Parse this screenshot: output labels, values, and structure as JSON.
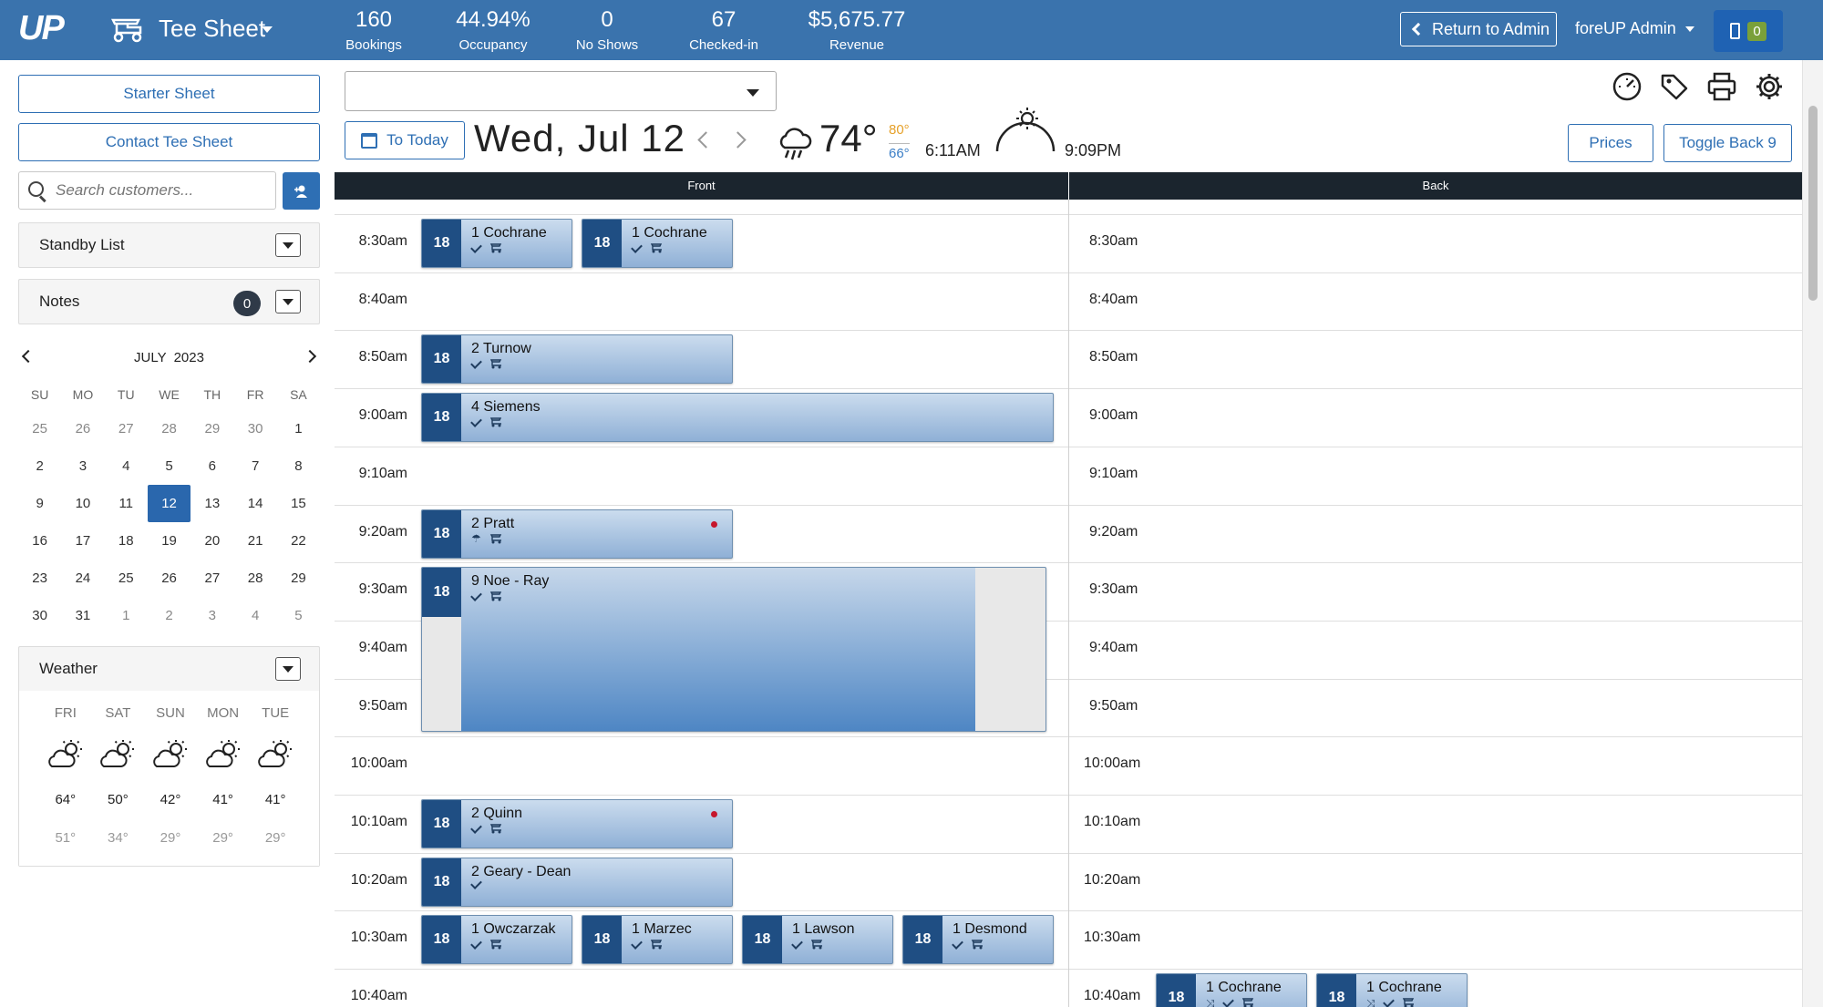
{
  "app": {
    "logo": "UP",
    "title": "Tee Sheet",
    "return_label": "Return to Admin",
    "admin_label": "foreUP Admin",
    "phone_count": "0",
    "cart_icon": "golf-cart-icon"
  },
  "stats": [
    {
      "value": "160",
      "label": "Bookings"
    },
    {
      "value": "44.94%",
      "label": "Occupancy"
    },
    {
      "value": "0",
      "label": "No Shows"
    },
    {
      "value": "67",
      "label": "Checked-in"
    },
    {
      "value": "$5,675.77",
      "label": "Revenue"
    }
  ],
  "sidebar": {
    "starter_sheet": "Starter Sheet",
    "contact_tee_sheet": "Contact Tee Sheet",
    "search_placeholder": "Search customers...",
    "standby": "Standby List",
    "notes": "Notes",
    "notes_count": "0",
    "weather": "Weather"
  },
  "calendar": {
    "month": "JULY",
    "year": "2023",
    "dow": [
      "SU",
      "MO",
      "TU",
      "WE",
      "TH",
      "FR",
      "SA"
    ],
    "days": [
      {
        "d": "25",
        "m": true
      },
      {
        "d": "26",
        "m": true
      },
      {
        "d": "27",
        "m": true
      },
      {
        "d": "28",
        "m": true
      },
      {
        "d": "29",
        "m": true
      },
      {
        "d": "30",
        "m": true
      },
      {
        "d": "1"
      },
      {
        "d": "2"
      },
      {
        "d": "3"
      },
      {
        "d": "4"
      },
      {
        "d": "5"
      },
      {
        "d": "6"
      },
      {
        "d": "7"
      },
      {
        "d": "8"
      },
      {
        "d": "9"
      },
      {
        "d": "10"
      },
      {
        "d": "11"
      },
      {
        "d": "12",
        "sel": true
      },
      {
        "d": "13"
      },
      {
        "d": "14"
      },
      {
        "d": "15"
      },
      {
        "d": "16"
      },
      {
        "d": "17"
      },
      {
        "d": "18"
      },
      {
        "d": "19"
      },
      {
        "d": "20"
      },
      {
        "d": "21"
      },
      {
        "d": "22"
      },
      {
        "d": "23"
      },
      {
        "d": "24"
      },
      {
        "d": "25"
      },
      {
        "d": "26"
      },
      {
        "d": "27"
      },
      {
        "d": "28"
      },
      {
        "d": "29"
      },
      {
        "d": "30"
      },
      {
        "d": "31"
      },
      {
        "d": "1",
        "m": true
      },
      {
        "d": "2",
        "m": true
      },
      {
        "d": "3",
        "m": true
      },
      {
        "d": "4",
        "m": true
      },
      {
        "d": "5",
        "m": true
      }
    ]
  },
  "forecast": [
    {
      "day": "FRI",
      "hi": "64°",
      "lo": "51°"
    },
    {
      "day": "SAT",
      "hi": "50°",
      "lo": "34°"
    },
    {
      "day": "SUN",
      "hi": "42°",
      "lo": "29°"
    },
    {
      "day": "MON",
      "hi": "41°",
      "lo": "29°"
    },
    {
      "day": "TUE",
      "hi": "41°",
      "lo": "29°"
    }
  ],
  "toolbar": {
    "course_value": "",
    "today_label": "To Today",
    "date": "Wed, Jul 12",
    "temp": "74°",
    "temp_hi": "80°",
    "temp_lo": "66°",
    "sunrise": "6:11AM",
    "sunset": "9:09PM",
    "prices": "Prices",
    "toggle_back": "Toggle Back 9",
    "icons": [
      "dashboard-icon",
      "tag-icon",
      "print-icon",
      "settings-icon"
    ]
  },
  "sheet": {
    "front": "Front",
    "back": "Back",
    "times": [
      "8:30am",
      "8:40am",
      "8:50am",
      "9:00am",
      "9:10am",
      "9:20am",
      "9:30am",
      "9:40am",
      "9:50am",
      "10:00am",
      "10:10am",
      "10:20am",
      "10:30am",
      "10:40am"
    ],
    "bookings": [
      {
        "row": 0,
        "side": "front",
        "slot": 0,
        "span": 1,
        "holes": "18",
        "name": "1  Cochrane",
        "marks": [
          "check",
          "cart"
        ]
      },
      {
        "row": 0,
        "side": "front",
        "slot": 1,
        "span": 1,
        "holes": "18",
        "name": "1  Cochrane",
        "marks": [
          "check",
          "cart"
        ]
      },
      {
        "row": 2,
        "side": "front",
        "slot": 0,
        "span": 2,
        "holes": "18",
        "name": "2  Turnow",
        "marks": [
          "check",
          "cart"
        ]
      },
      {
        "row": 3,
        "side": "front",
        "slot": 0,
        "span": 4,
        "holes": "18",
        "name": "4  Siemens",
        "marks": [
          "check",
          "cart"
        ]
      },
      {
        "row": 5,
        "side": "front",
        "slot": 0,
        "span": 2,
        "holes": "18",
        "name": "2  Pratt",
        "marks": [
          "umbrella",
          "cart"
        ],
        "dot": true
      },
      {
        "row": 10,
        "side": "front",
        "slot": 0,
        "span": 2,
        "holes": "18",
        "name": "2  Quinn",
        "marks": [
          "check",
          "cart"
        ],
        "dot": true
      },
      {
        "row": 11,
        "side": "front",
        "slot": 0,
        "span": 2,
        "holes": "18",
        "name": "2  Geary - Dean",
        "marks": [
          "check"
        ]
      },
      {
        "row": 12,
        "side": "front",
        "slot": 0,
        "span": 1,
        "holes": "18",
        "name": "1  Owczarzak",
        "marks": [
          "check",
          "cart"
        ]
      },
      {
        "row": 12,
        "side": "front",
        "slot": 1,
        "span": 1,
        "holes": "18",
        "name": "1  Marzec",
        "marks": [
          "check",
          "cart"
        ]
      },
      {
        "row": 12,
        "side": "front",
        "slot": 2,
        "span": 1,
        "holes": "18",
        "name": "1  Lawson",
        "marks": [
          "check",
          "cart"
        ]
      },
      {
        "row": 12,
        "side": "front",
        "slot": 3,
        "span": 1,
        "holes": "18",
        "name": "1  Desmond",
        "marks": [
          "check",
          "cart"
        ]
      },
      {
        "row": 13,
        "side": "back",
        "slot": 0,
        "span": 1,
        "holes": "18",
        "name": "1  Cochrane",
        "marks": [
          "shuffle",
          "check",
          "cart"
        ]
      },
      {
        "row": 13,
        "side": "back",
        "slot": 1,
        "span": 1,
        "holes": "18",
        "name": "1  Cochrane",
        "marks": [
          "shuffle",
          "check",
          "cart"
        ]
      }
    ],
    "group": {
      "row": 6,
      "rows": 3,
      "holes": "18",
      "name": "9  Noe - Ray",
      "marks": [
        "check",
        "cart"
      ]
    }
  }
}
